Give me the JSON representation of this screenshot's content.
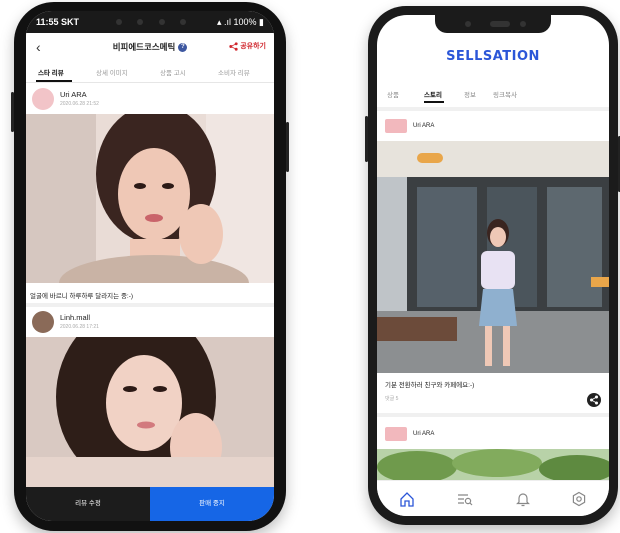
{
  "left_phone": {
    "status": {
      "carrier_time": "11:55 SKT",
      "battery": "100%"
    },
    "header": {
      "back": "‹",
      "title": "비피에드코스메틱",
      "info": "?",
      "share_label": "공유하기"
    },
    "tabs": [
      "스타 리뷰",
      "상세 이미지",
      "상품 고시",
      "소비자 리뷰"
    ],
    "posts": [
      {
        "name": "Uri ARA",
        "date": "2020.06.28 21:52",
        "caption": "얼굴에 바르니 하루하루 달라지는 중:-)"
      },
      {
        "name": "Linh.mall",
        "date": "2020.06.28 17:21",
        "caption": ""
      }
    ],
    "bottom": {
      "edit_label": "리뷰 수정",
      "stop_label": "판매 중지"
    },
    "colors": {
      "accent": "#1666e6",
      "share": "#d0262d"
    }
  },
  "right_phone": {
    "logo": "SELLSATION",
    "tabs": [
      "상품",
      "스토리",
      "정보",
      "링크복사"
    ],
    "posts": [
      {
        "name": "Uri ARA",
        "caption": "기분 전환하러 친구와 카페에요:-)",
        "sub": "댓글 5"
      },
      {
        "name": "Uri ARA"
      }
    ],
    "nav": [
      "home-icon",
      "list-search-icon",
      "bell-icon",
      "gear-icon"
    ],
    "colors": {
      "logo": "#2b56d8"
    }
  }
}
